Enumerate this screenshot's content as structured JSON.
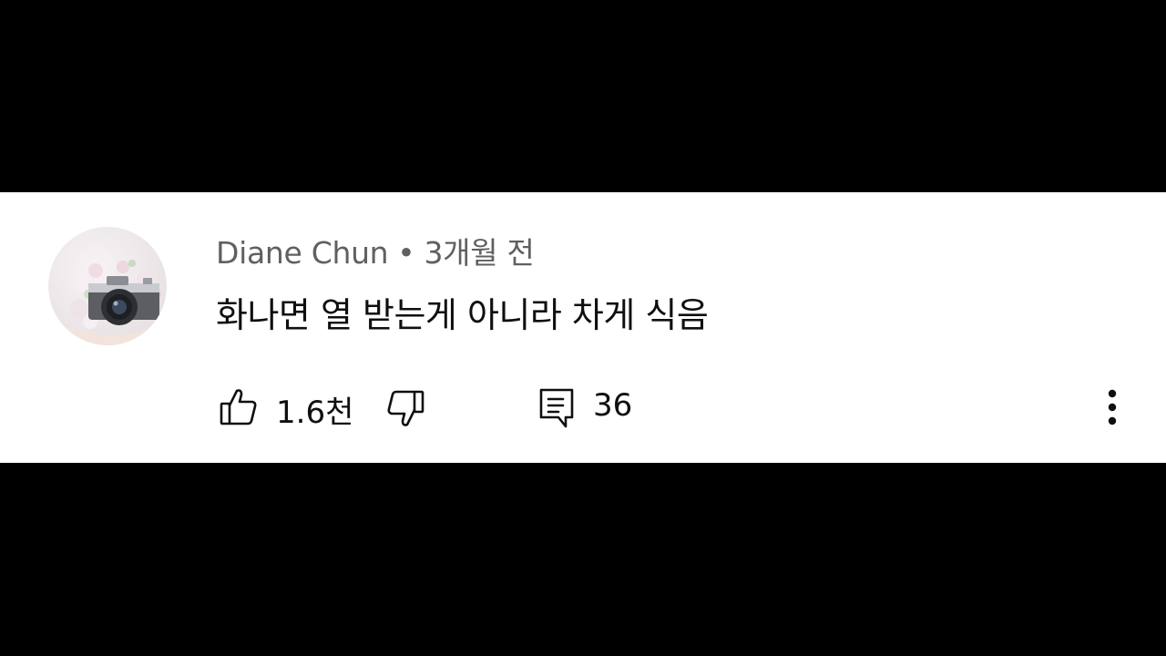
{
  "comment": {
    "author": "Diane Chun",
    "separator": "•",
    "time": "3개월 전",
    "text": "화나면 열 받는게 아니라 차게 식음",
    "like_count": "1.6천",
    "reply_count": "36"
  },
  "icons": {
    "avatar": "avatar-camera-flowers",
    "like": "thumbs-up-icon",
    "dislike": "thumbs-down-icon",
    "reply": "comment-icon",
    "more": "more-vert-icon"
  },
  "colors": {
    "background": "#000000",
    "card": "#ffffff",
    "meta_text": "#606060",
    "body_text": "#0f0f0f"
  }
}
